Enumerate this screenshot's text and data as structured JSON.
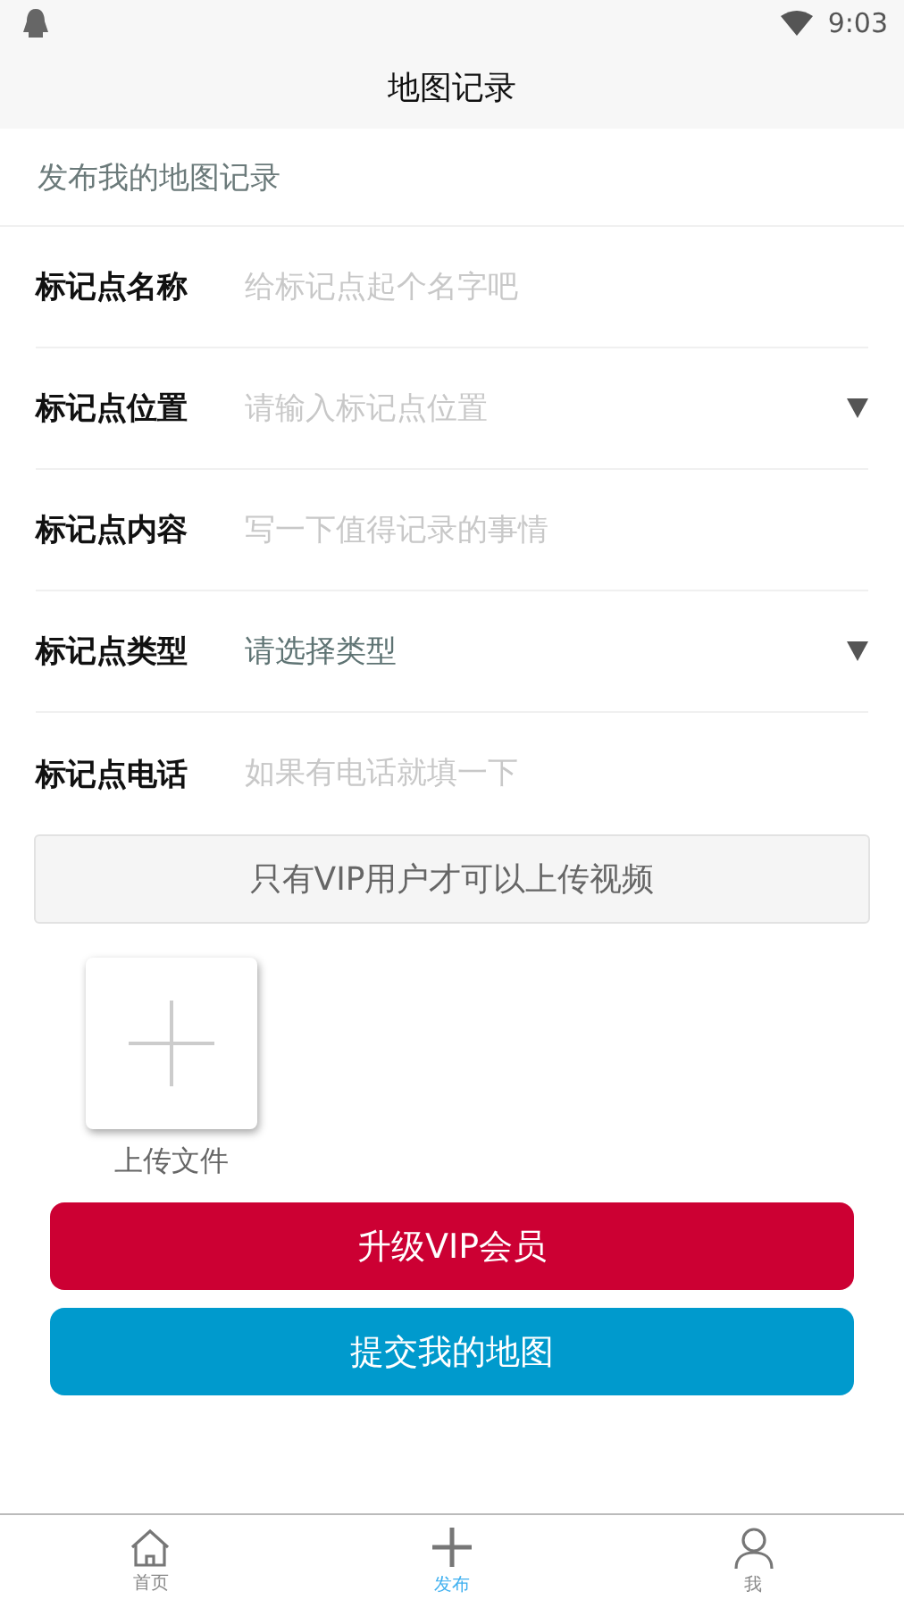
{
  "status_bar": {
    "time": "9:03"
  },
  "title": "地图记录",
  "section_header": "发布我的地图记录",
  "fields": [
    {
      "label": "标记点名称",
      "kind": "input",
      "placeholder": "给标记点起个名字吧"
    },
    {
      "label": "标记点位置",
      "kind": "select",
      "placeholder": "请输入标记点位置"
    },
    {
      "label": "标记点内容",
      "kind": "input",
      "placeholder": "写一下值得记录的事情"
    },
    {
      "label": "标记点类型",
      "kind": "select",
      "value": "请选择类型"
    },
    {
      "label": "标记点电话",
      "kind": "input",
      "placeholder": "如果有电话就填一下"
    }
  ],
  "vip_notice": "只有VIP用户才可以上传视频",
  "upload": {
    "label": "上传文件"
  },
  "buttons": [
    {
      "label": "升级VIP会员",
      "color": "#cc0033"
    },
    {
      "label": "提交我的地图",
      "color": "#009acd"
    }
  ],
  "tabs": [
    {
      "label": "首页",
      "selected": false
    },
    {
      "label": "发布",
      "selected": true
    },
    {
      "label": "我",
      "selected": false
    }
  ]
}
